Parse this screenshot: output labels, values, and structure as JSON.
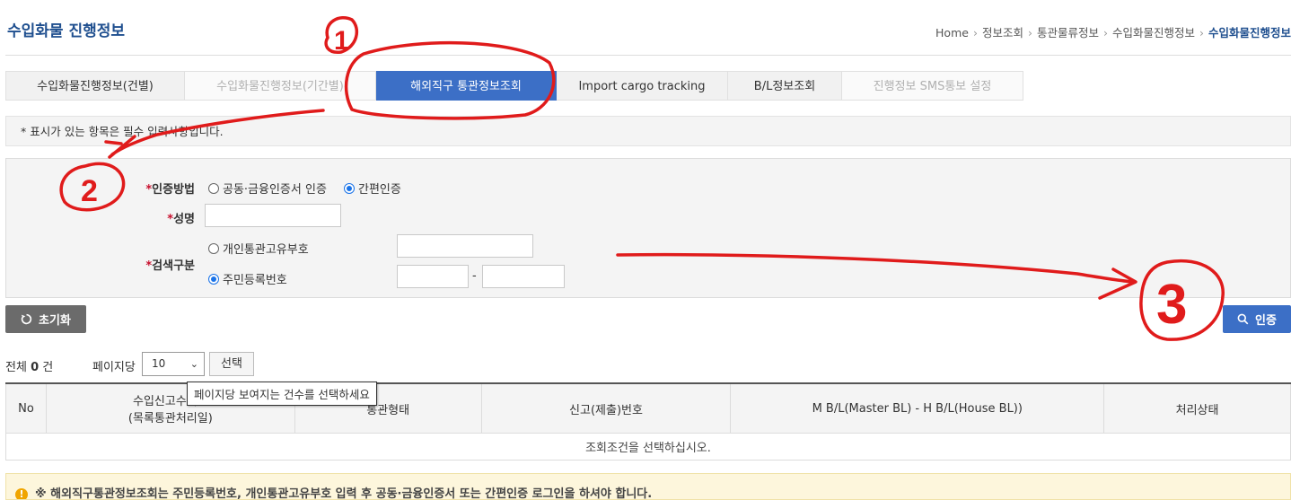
{
  "page": {
    "title": "수입화물 진행정보",
    "breadcrumb": [
      "Home",
      "정보조회",
      "통관물류정보",
      "수입화물진행정보",
      "수입화물진행정보"
    ]
  },
  "tabs": [
    {
      "label": "수입화물진행정보(건별)",
      "state": "normal"
    },
    {
      "label": "수입화물진행정보(기간별)",
      "state": "disabled"
    },
    {
      "label": "해외직구 통관정보조회",
      "state": "active"
    },
    {
      "label": "Import cargo tracking",
      "state": "normal"
    },
    {
      "label": "B/L정보조회",
      "state": "normal"
    },
    {
      "label": "진행정보 SMS통보 설정",
      "state": "disabled"
    }
  ],
  "notice": "* 표시가 있는 항목은 필수 입력사항입니다.",
  "form": {
    "required_mark": "*",
    "auth_label": "인증방법",
    "auth_options": [
      "공동·금융인증서 인증",
      "간편인증"
    ],
    "name_label": "성명",
    "search_label": "검색구분",
    "search_options": [
      "개인통관고유부호",
      "주민등록번호"
    ],
    "dash": "-"
  },
  "buttons": {
    "reset": "초기화",
    "auth": "인증",
    "select": "선택"
  },
  "list": {
    "total_prefix": "전체",
    "total_count": "0",
    "total_suffix": "건",
    "perpage_label": "페이지당",
    "perpage_value": "10",
    "tooltip": "페이지당 보여지는 건수를 선택하세요",
    "columns": [
      "No",
      "수입신고수리일",
      "(목록통관처리일)",
      "통관형태",
      "신고(제출)번호",
      "M B/L(Master BL) - H B/L(House BL))",
      "처리상태"
    ],
    "empty_message": "조회조건을 선택하십시오."
  },
  "warning": "※ 해외직구통관정보조회는 주민등록번호, 개인통관고유부호 입력 후 공동·금융인증서 또는 간편인증 로그인을 하셔야 합니다.",
  "annotations": [
    "1",
    "2",
    "3"
  ],
  "colors": {
    "primary": "#3c6fc6",
    "title": "#1f4f8f",
    "annotation": "#e01b1b"
  }
}
